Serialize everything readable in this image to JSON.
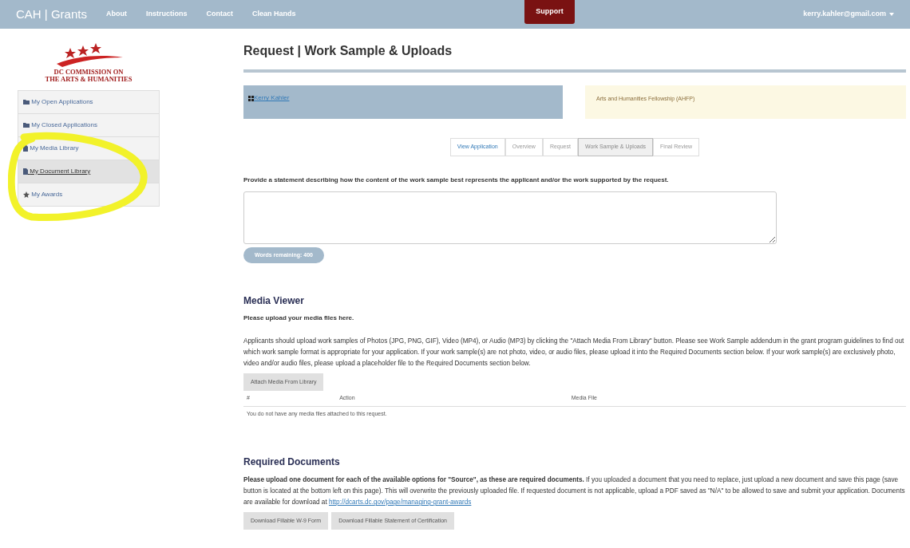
{
  "navbar": {
    "brand": "CAH | Grants",
    "links": [
      "About",
      "Instructions",
      "Contact",
      "Clean Hands"
    ],
    "support": "Support",
    "user": "kerry.kahler@gmail.com"
  },
  "logo": {
    "line1": "DC COMMISSION ON",
    "line2": "THE ARTS & HUMANITIES"
  },
  "sidebar": {
    "items": [
      {
        "label": "My Open Applications",
        "kind": "folder",
        "hovered": false
      },
      {
        "label": "My Closed Applications",
        "kind": "folder",
        "hovered": false
      },
      {
        "label": "My Media Library",
        "kind": "file",
        "hovered": false
      },
      {
        "label": "My Document Library",
        "kind": "file",
        "hovered": true
      },
      {
        "label": "My Awards",
        "kind": "star",
        "hovered": false
      }
    ]
  },
  "page_title": "Request | Work Sample & Uploads",
  "applicant": "Kerry Kahler",
  "program": "Arts and Humanities Fellowship (AHFP)",
  "tabs": [
    {
      "label": "View Application",
      "kind": "link",
      "selected": false
    },
    {
      "label": "Overview",
      "kind": "plain",
      "selected": false
    },
    {
      "label": "Request",
      "kind": "plain",
      "selected": false
    },
    {
      "label": "Work Sample & Uploads",
      "kind": "plain",
      "selected": true
    },
    {
      "label": "Final Review",
      "kind": "plain",
      "selected": false
    }
  ],
  "statement": {
    "label": "Provide a statement describing how the content of the work sample best represents the applicant and/or the work supported by the request.",
    "counter": "Words remaining: 400"
  },
  "media_viewer": {
    "heading": "Media Viewer",
    "subheading": "Please upload your media files here.",
    "text": "Applicants should upload work samples of Photos (JPG, PNG, GIF), Video (MP4), or Audio (MP3) by clicking the \"Attach Media From Library\" button. Please see Work Sample addendum in the grant program guidelines to find out which work sample format is appropriate for your application. If your work sample(s) are not photo, video, or audio files, please upload it into the Required Documents section below. If your work sample(s) are exclusively photo, video and/or audio files, please upload a placeholder file to the Required Documents section below.",
    "button": "Attach Media From Library",
    "table": {
      "columns": [
        "#",
        "Action",
        "Media File"
      ],
      "empty": "You do not have any media files attached to this request."
    }
  },
  "required_documents": {
    "heading": "Required Documents",
    "text_bold": "Please upload one document for each of the available options for \"Source\", as these are required documents.",
    "text": " If you uploaded a document that you need to replace, just upload a new document and save this page (save button is located at the bottom left on this page). This will overwrite the previously uploaded file. If requested document is not applicable, upload a PDF saved as \"N/A\" to be allowed to save and submit your application. Documents are available for download at ",
    "link": "http://dcarts.dc.gov/page/managing-grant-awards",
    "buttons": [
      "Download Fillable W-9 Form",
      "Download Fillable Statement of Certification"
    ]
  }
}
